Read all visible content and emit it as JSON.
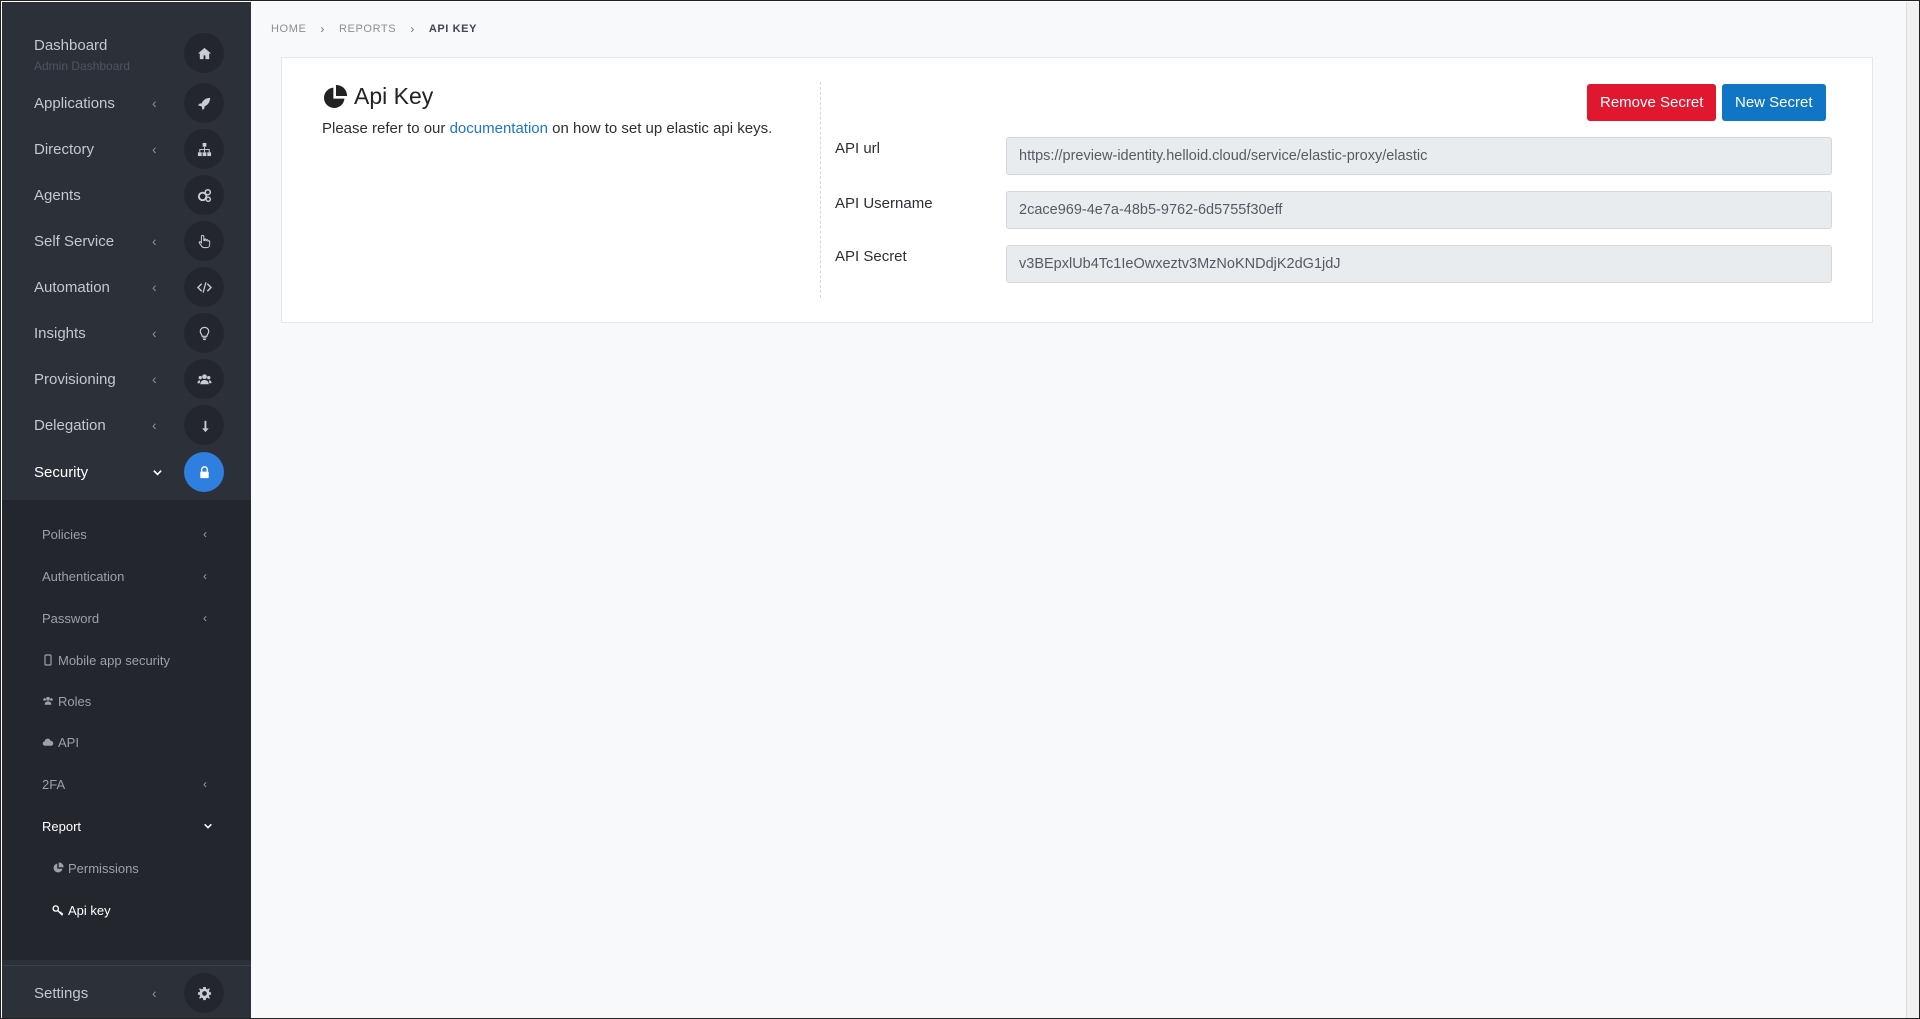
{
  "sidebar": {
    "dashboard": {
      "label": "Dashboard",
      "sub": "Admin Dashboard"
    },
    "items": [
      {
        "label": "Applications",
        "icon": "rocket-icon"
      },
      {
        "label": "Directory",
        "icon": "sitemap-icon"
      },
      {
        "label": "Agents",
        "icon": "cogs-icon"
      },
      {
        "label": "Self Service",
        "icon": "hand-pointer-icon"
      },
      {
        "label": "Automation",
        "icon": "code-icon"
      },
      {
        "label": "Insights",
        "icon": "lightbulb-icon"
      },
      {
        "label": "Provisioning",
        "icon": "users-icon"
      },
      {
        "label": "Delegation",
        "icon": "level-down-icon"
      },
      {
        "label": "Security",
        "icon": "lock-icon"
      }
    ],
    "security_submenu": [
      {
        "label": "Policies"
      },
      {
        "label": "Authentication"
      },
      {
        "label": "Password"
      },
      {
        "label": "Mobile app security"
      },
      {
        "label": "Roles"
      },
      {
        "label": "API"
      },
      {
        "label": "2FA"
      },
      {
        "label": "Report"
      }
    ],
    "report_submenu": [
      {
        "label": "Permissions"
      },
      {
        "label": "Api key"
      }
    ],
    "settings": {
      "label": "Settings"
    },
    "accent_color": "#2f7fe0"
  },
  "breadcrumb": {
    "home": "HOME",
    "reports": "REPORTS",
    "current": "API KEY"
  },
  "card": {
    "title": "Api Key",
    "desc_before": "Please refer to our ",
    "desc_link": "documentation",
    "desc_after": " on how to set up elastic api keys.",
    "remove_button": "Remove Secret",
    "new_button": "New Secret",
    "fields": [
      {
        "label": "API url",
        "value": "https://preview-identity.helloid.cloud/service/elastic-proxy/elastic"
      },
      {
        "label": "API Username",
        "value": "2cace969-4e7a-48b5-9762-6d5755f30eff"
      },
      {
        "label": "API Secret",
        "value": "v3BEpxlUb4Tc1IeOwxeztv3MzNoKNDdjK2dG1jdJ"
      }
    ]
  }
}
